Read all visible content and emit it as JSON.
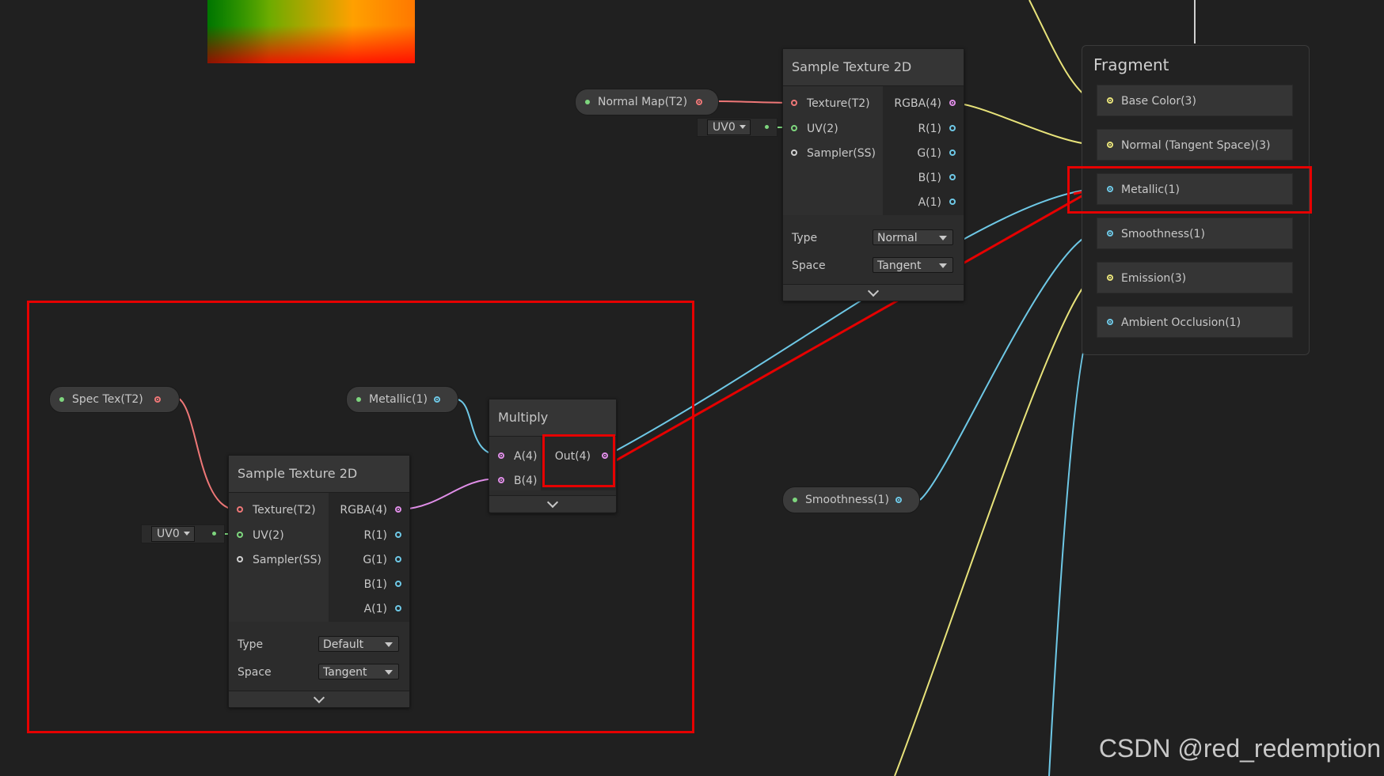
{
  "colors": {
    "background": "#202020",
    "highlight": "#e60000",
    "port_texture": "#ee7777",
    "port_uv": "#7ed67e",
    "port_vector4": "#e08ee8",
    "port_vector1": "#6ec8e6",
    "port_vector3": "#e8e37a",
    "port_sampler": "#d0d0d0"
  },
  "top_sample_texture": {
    "title": "Sample Texture 2D",
    "inputs": [
      "Texture(T2)",
      "UV(2)",
      "Sampler(SS)"
    ],
    "outputs": [
      "RGBA(4)",
      "R(1)",
      "G(1)",
      "B(1)",
      "A(1)"
    ],
    "type_label": "Type",
    "type_value": "Normal",
    "space_label": "Space",
    "space_value": "Tangent"
  },
  "bottom_sample_texture": {
    "title": "Sample Texture 2D",
    "inputs": [
      "Texture(T2)",
      "UV(2)",
      "Sampler(SS)"
    ],
    "outputs": [
      "RGBA(4)",
      "R(1)",
      "G(1)",
      "B(1)",
      "A(1)"
    ],
    "type_label": "Type",
    "type_value": "Default",
    "space_label": "Space",
    "space_value": "Tangent"
  },
  "multiply": {
    "title": "Multiply",
    "inputs": [
      "A(4)",
      "B(4)"
    ],
    "output": "Out(4)"
  },
  "properties": {
    "normal_map": "Normal Map(T2)",
    "spec_tex": "Spec Tex(T2)",
    "metallic": "Metallic(1)",
    "smoothness": "Smoothness(1)"
  },
  "uv_dropdowns": {
    "top": "UV0",
    "bottom": "UV0"
  },
  "fragment": {
    "title": "Fragment",
    "blocks": [
      {
        "label": "Base Color(3)",
        "color": "#e8e37a"
      },
      {
        "label": "Normal (Tangent Space)(3)",
        "color": "#e8e37a"
      },
      {
        "label": "Metallic(1)",
        "color": "#6ec8e6"
      },
      {
        "label": "Smoothness(1)",
        "color": "#6ec8e6"
      },
      {
        "label": "Emission(3)",
        "color": "#e8e37a"
      },
      {
        "label": "Ambient Occlusion(1)",
        "color": "#6ec8e6"
      }
    ]
  },
  "watermark": "CSDN @red_redemption"
}
